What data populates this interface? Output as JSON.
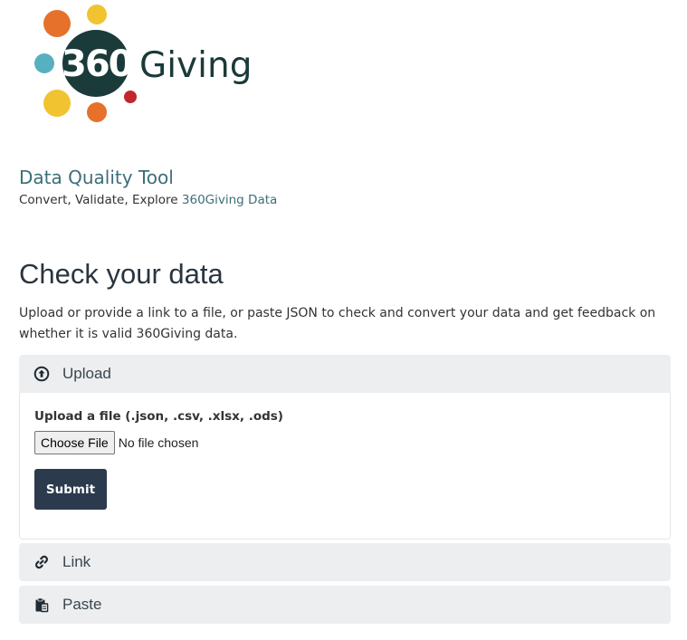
{
  "logo": {
    "number": "360",
    "wordmark": "Giving",
    "colors": {
      "dark": "#1b3a3a",
      "orange": "#e5712a",
      "yellow": "#f1c330",
      "teal": "#56b0c0",
      "red": "#c1272d"
    }
  },
  "header": {
    "title": "Data Quality Tool",
    "subtitle_prefix": "Convert, Validate, Explore ",
    "subtitle_highlight": "360Giving Data"
  },
  "main": {
    "heading": "Check your data",
    "intro": "Upload or provide a link to a file, or paste JSON to check and convert your data and get feedback on whether it is valid 360Giving data."
  },
  "accordion": {
    "upload": {
      "label": "Upload",
      "icon": "arrow-circle-up-icon",
      "field_label": "Upload a file (.json, .csv, .xlsx, .ods)",
      "choose_label": "Choose File",
      "file_status": "No file chosen",
      "submit_label": "Submit"
    },
    "link": {
      "label": "Link",
      "icon": "link-icon"
    },
    "paste": {
      "label": "Paste",
      "icon": "clipboard-paste-icon"
    }
  },
  "colors": {
    "accent": "#3d6e78",
    "submit": "#2b3a4d",
    "panel": "#eceeef"
  }
}
